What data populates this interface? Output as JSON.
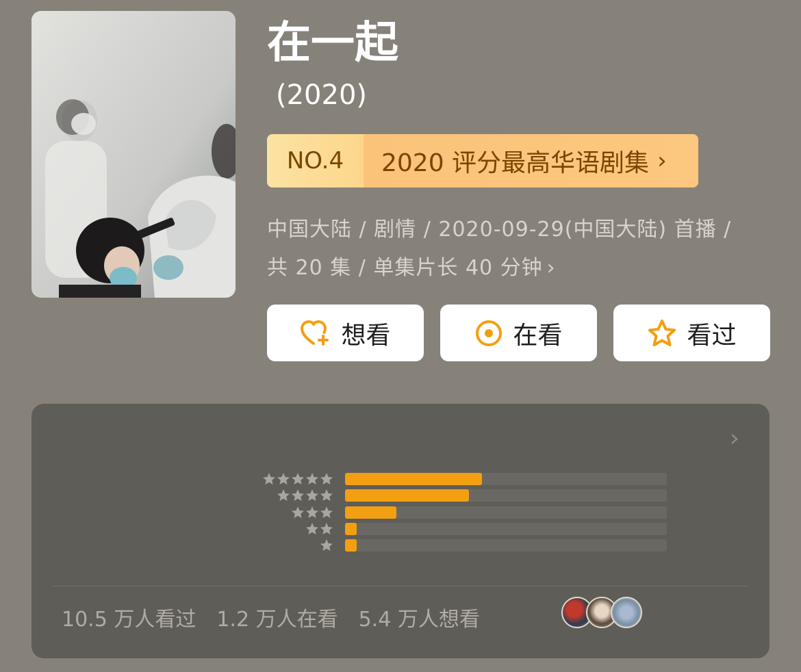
{
  "show": {
    "title": "在一起",
    "year": "(2020)"
  },
  "rank": {
    "number": "NO.4",
    "label": "2020 评分最高华语剧集",
    "chevron": "›"
  },
  "meta": {
    "line1": "中国大陆 / 剧情 / 2020-09-29(中国大陆) 首播 /",
    "line2": "共 20 集 / 单集片长 40 分钟",
    "chevron": "›"
  },
  "actions": [
    {
      "label": "想看",
      "icon": "heart-plus-icon"
    },
    {
      "label": "在看",
      "icon": "circle-dot-icon"
    },
    {
      "label": "看过",
      "icon": "star-outline-icon"
    }
  ],
  "rating": {
    "chevron": "›",
    "distribution": [
      {
        "stars": 5,
        "fraction": 0.425
      },
      {
        "stars": 4,
        "fraction": 0.385
      },
      {
        "stars": 3,
        "fraction": 0.16
      },
      {
        "stars": 2,
        "fraction": 0.037
      },
      {
        "stars": 1,
        "fraction": 0.037
      }
    ],
    "stats": {
      "watched": "10.5 万人看过",
      "watching": "1.2 万人在看",
      "want": "5.4 万人想看"
    }
  },
  "colors": {
    "background": "#86827a",
    "card": "#5f5d57",
    "accent": "#f39f12",
    "rank_text": "#7a4500"
  }
}
